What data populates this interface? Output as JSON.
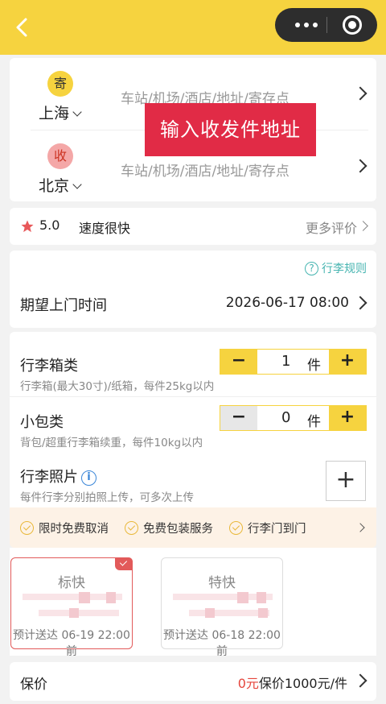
{
  "colors": {
    "accent_yellow": "#f6d33f",
    "alert_red": "#e12b46",
    "teal": "#45b4b0"
  },
  "icons": [
    "back-icon",
    "more-icon",
    "close-miniapp-icon",
    "star-icon",
    "chevron-right-icon",
    "question-icon",
    "info-icon",
    "check-circle-icon",
    "plus-icon"
  ],
  "address": {
    "sender": {
      "badge": "寄",
      "city": "上海",
      "placeholder": "车站/机场/酒店/地址/寄存点"
    },
    "receiver": {
      "badge": "收",
      "city": "北京",
      "placeholder": "车站/机场/酒店/地址/寄存点"
    },
    "overlay_text": "输入收发件地址"
  },
  "rating": {
    "score": "5.0",
    "tag": "速度很快",
    "more": "更多评价"
  },
  "pickup": {
    "rules_label": "行李规则",
    "label": "期望上门时间",
    "value": "2026-06-17 08:00"
  },
  "luggage": {
    "suitcase": {
      "title": "行李箱类",
      "desc": "行李箱(最大30寸)/纸箱，每件25kg以内",
      "count": "1",
      "unit": "件"
    },
    "bag": {
      "title": "小包类",
      "desc": "背包/超重行李箱续重，每件10kg以内",
      "count": "0",
      "unit": "件"
    },
    "photo": {
      "title": "行李照片",
      "desc": "每件行李分别拍照上传，可多次上传"
    }
  },
  "services": [
    "限时免费取消",
    "免费包装服务",
    "行李门到门"
  ],
  "speed_options": [
    {
      "name": "标快",
      "eta": "预计送达 06-19 22:00前",
      "selected": true
    },
    {
      "name": "特快",
      "eta": "预计送达 06-18 22:00前",
      "selected": false
    }
  ],
  "insurance": {
    "label": "保价",
    "price": "0元",
    "detail": "保价1000元/件"
  }
}
